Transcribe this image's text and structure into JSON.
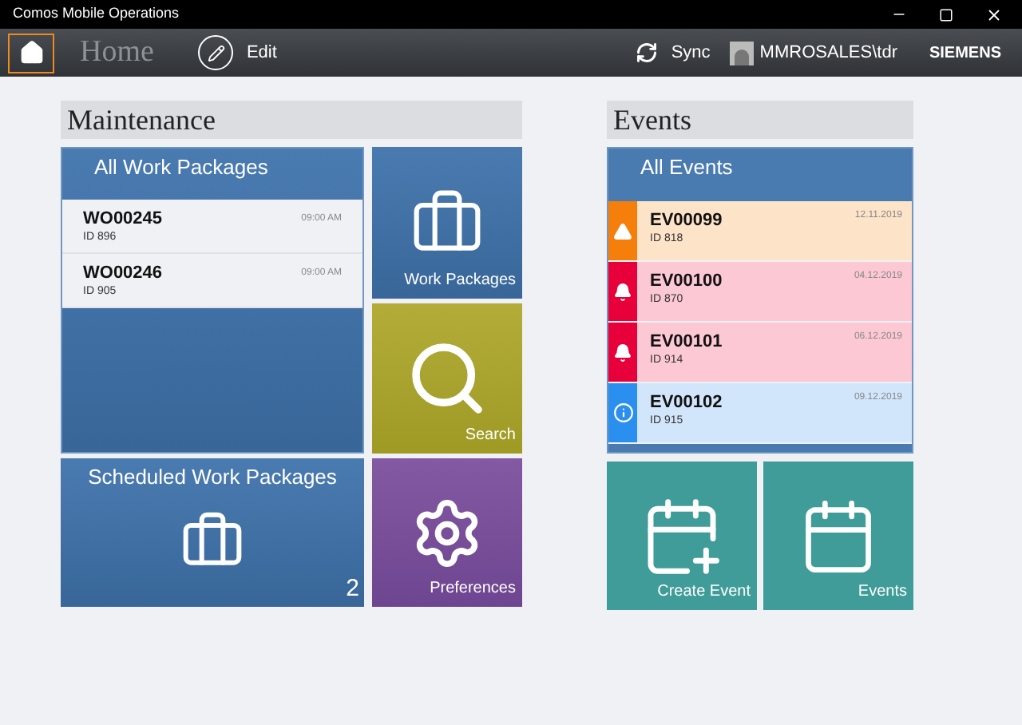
{
  "window": {
    "title": "Comos Mobile Operations"
  },
  "toolbar": {
    "title": "Home",
    "edit": "Edit",
    "sync": "Sync",
    "user": "MMROSALES\\tdr",
    "brand": "SIEMENS"
  },
  "maintenance": {
    "title": "Maintenance",
    "all_packages": {
      "title": "All Work Packages",
      "items": [
        {
          "name": "WO00245",
          "id": "ID 896",
          "time": "09:00 AM"
        },
        {
          "name": "WO00246",
          "id": "ID 905",
          "time": "09:00 AM"
        }
      ]
    },
    "tiles": [
      {
        "kind": "packages",
        "label": "Work Packages"
      },
      {
        "kind": "search",
        "label": "Search"
      }
    ],
    "scheduled": {
      "title": "Scheduled Work Packages",
      "count": "2"
    },
    "preferences": "Preferences"
  },
  "events": {
    "title": "Events",
    "all_events": {
      "title": "All Events",
      "items": [
        {
          "kind": "warning",
          "color": "#f57f0a",
          "name": "EV00099",
          "id": "ID 818",
          "date": "12.11.2019"
        },
        {
          "kind": "alarm",
          "color": "#e8003a",
          "name": "EV00100",
          "id": "ID 870",
          "date": "04.12.2019"
        },
        {
          "kind": "alarm",
          "color": "#e8003a",
          "name": "EV00101",
          "id": "ID 914",
          "date": "06.12.2019"
        },
        {
          "kind": "info",
          "color": "#2b8fef",
          "name": "EV00102",
          "id": "ID 915",
          "date": "09.12.2019"
        }
      ]
    },
    "tiles": [
      {
        "kind": "create",
        "label": "Create Event"
      },
      {
        "kind": "calendar",
        "label": "Events"
      }
    ]
  }
}
